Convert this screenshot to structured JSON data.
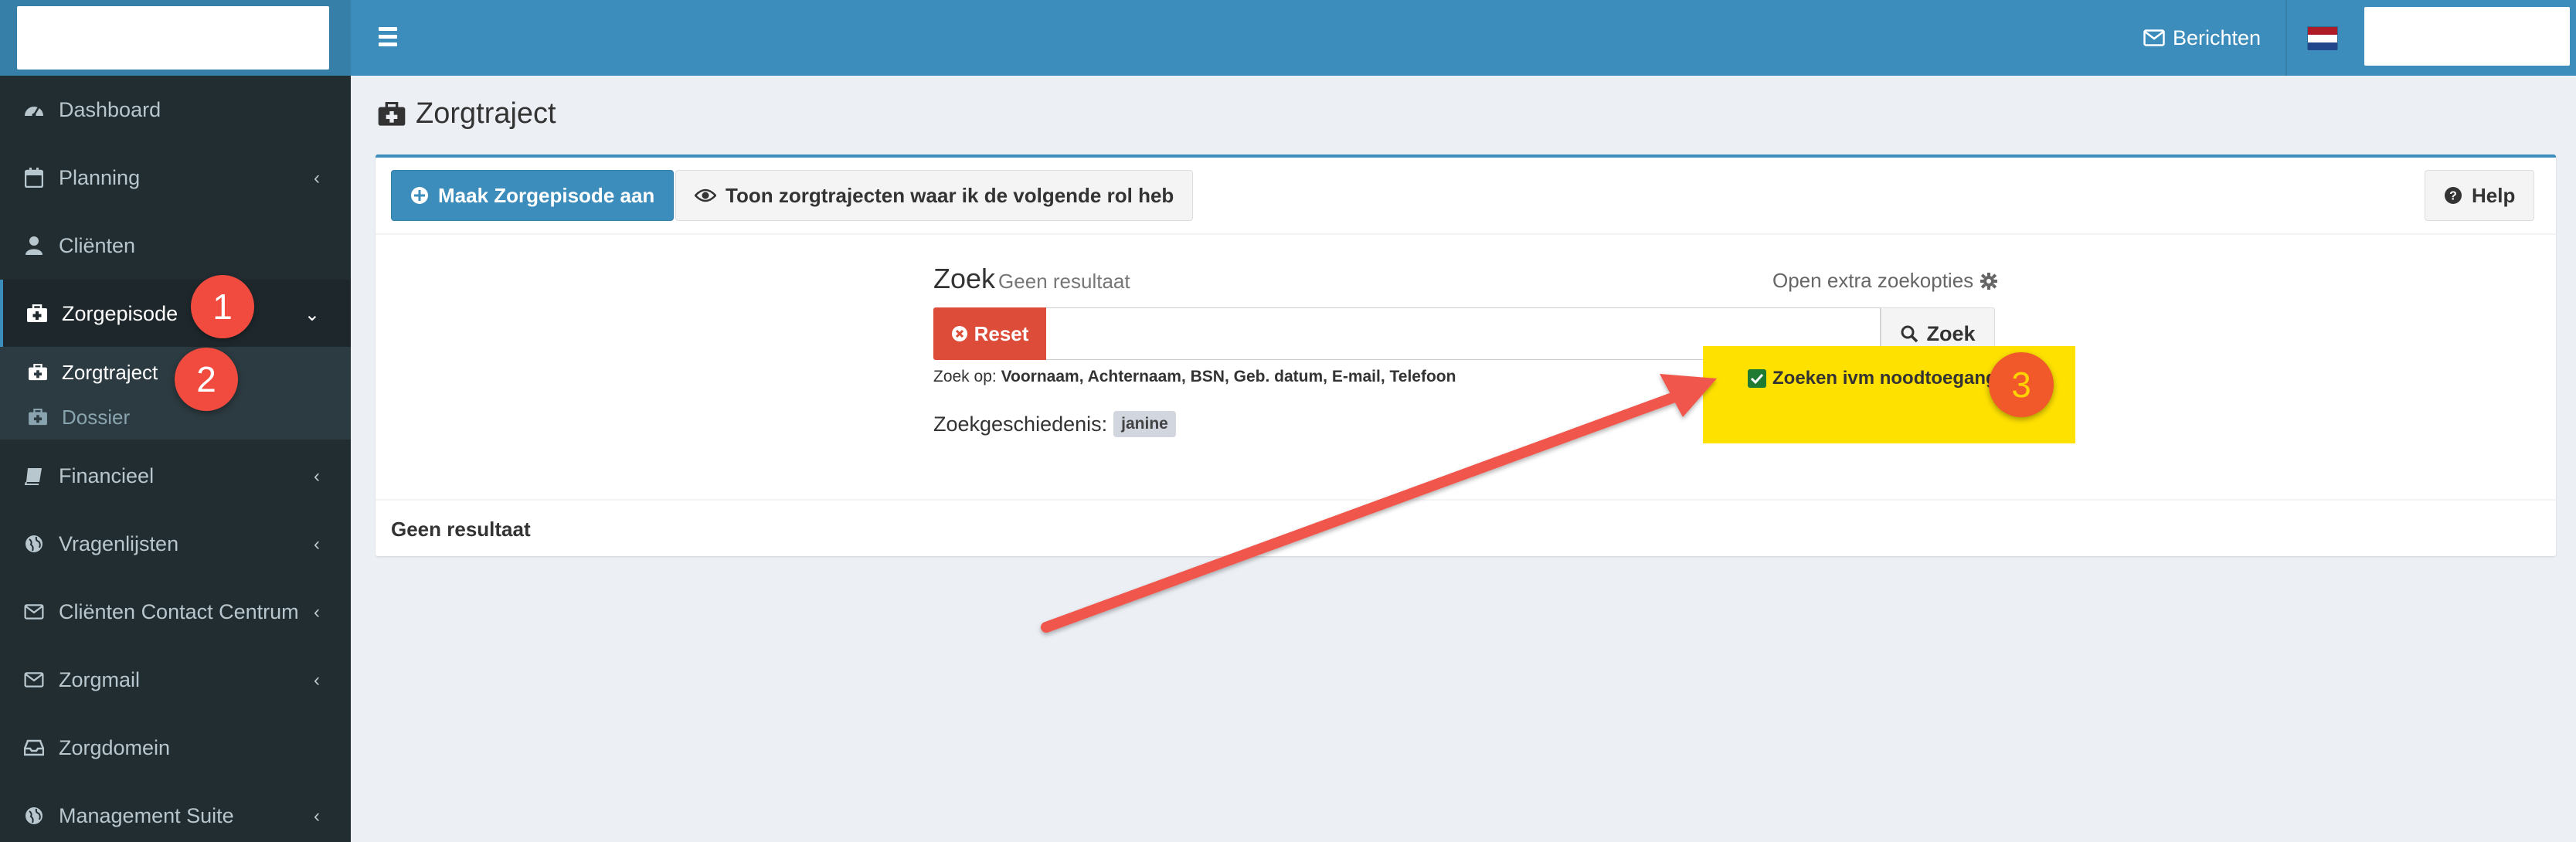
{
  "header": {
    "messages_label": "Berichten"
  },
  "sidebar": {
    "items": [
      {
        "label": "Dashboard",
        "icon": "dashboard-icon"
      },
      {
        "label": "Planning",
        "icon": "calendar-icon"
      },
      {
        "label": "Cliënten",
        "icon": "user-icon"
      },
      {
        "label": "Zorgepisode",
        "icon": "medkit-icon"
      },
      {
        "label": "Financieel",
        "icon": "book-icon"
      },
      {
        "label": "Vragenlijsten",
        "icon": "globe-icon"
      },
      {
        "label": "Cliënten Contact Centrum",
        "icon": "envelope-icon"
      },
      {
        "label": "Zorgmail",
        "icon": "envelope-icon"
      },
      {
        "label": "Zorgdomein",
        "icon": "inbox-icon"
      },
      {
        "label": "Management Suite",
        "icon": "globe-icon"
      }
    ],
    "submenu": [
      {
        "label": "Zorgtraject",
        "icon": "medkit-icon"
      },
      {
        "label": "Dossier",
        "icon": "medkit-icon"
      }
    ]
  },
  "annotations": {
    "badge1": "1",
    "badge2": "2",
    "badge3": "3"
  },
  "main": {
    "title": "Zorgtraject",
    "create_button": "Maak Zorgepisode aan",
    "show_button": "Toon zorgtrajecten waar ik de volgende rol heb",
    "help_button": "Help",
    "search": {
      "title": "Zoek",
      "subtitle": "Geen resultaat",
      "open_extra": "Open extra zoekopties",
      "reset_label": "Reset",
      "input_value": "",
      "search_button": "Zoek",
      "hint_prefix": "Zoek op:",
      "hint_fields": "Voornaam, Achternaam, BSN, Geb. datum, E-mail, Telefoon",
      "checkbox_label": "Zoeken ivm noodtoegang",
      "history_label": "Zoekgeschiedenis:",
      "history_tag": "janine"
    },
    "result_text": "Geen resultaat"
  },
  "colors": {
    "header": "#3c8dbc",
    "sidebar": "#222d32",
    "reset": "#dd4b39",
    "highlight": "#ffe100",
    "arrow": "#f0574b"
  }
}
